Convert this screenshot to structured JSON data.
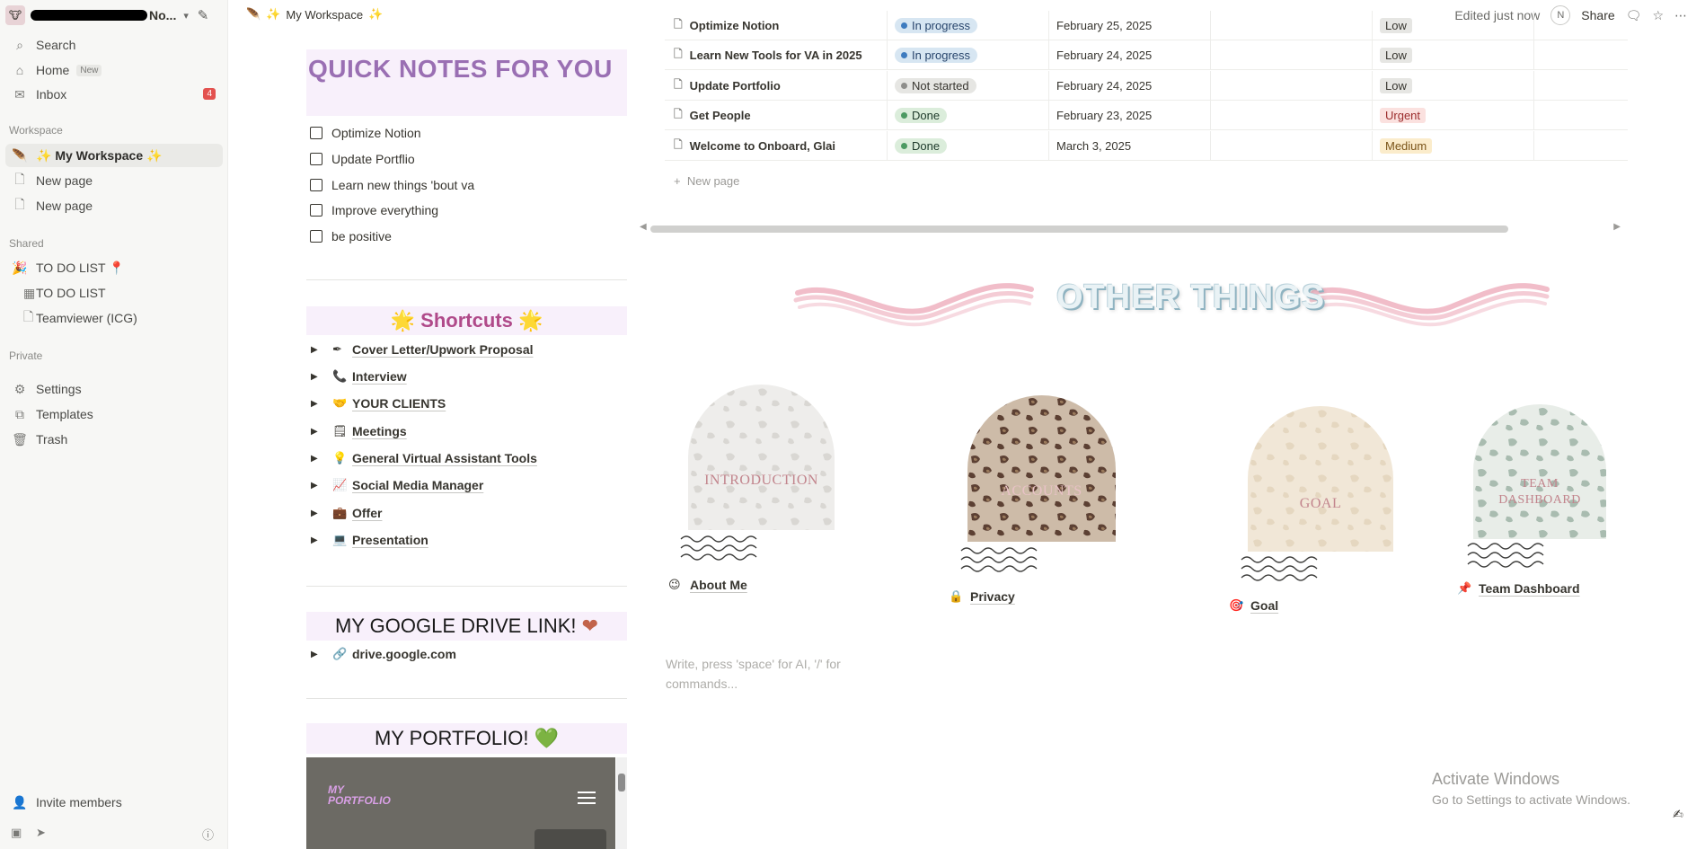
{
  "sidebar": {
    "workspace_suffix": "No...",
    "items": {
      "search": "Search",
      "home": "Home",
      "home_tag": "New",
      "inbox": "Inbox",
      "inbox_count": "4"
    },
    "sections": {
      "workspace": "Workspace",
      "shared": "Shared",
      "private": "Private"
    },
    "workspace_pages": [
      "My Workspace",
      "New page",
      "New page"
    ],
    "shared_pages": [
      "TO DO LIST",
      "TO DO LIST",
      "Teamviewer (ICG)"
    ],
    "private_items": [
      "Settings",
      "Templates",
      "Trash"
    ],
    "invite": "Invite members"
  },
  "topbar": {
    "breadcrumb": "My Workspace",
    "edited": "Edited just now",
    "avatar_initial": "N",
    "share": "Share"
  },
  "quick_notes": {
    "title": "QUICK NOTES FOR YOU",
    "todos": [
      "Optimize Notion",
      "Update Portflio",
      "Learn new things 'bout va",
      "Improve everything",
      "be positive"
    ]
  },
  "shortcuts": {
    "title": "Shortcuts",
    "items": [
      "Cover Letter/Upwork Proposal",
      "Interview",
      "YOUR CLIENTS",
      "Meetings",
      "General Virtual Assistant Tools",
      "Social Media Manager",
      "Offer",
      "Presentation"
    ]
  },
  "google_drive": {
    "title": "MY GOOGLE DRIVE LINK!",
    "link": "drive.google.com"
  },
  "portfolio": {
    "title": "MY PORTFOLIO!",
    "logo_line1": "MY",
    "logo_line2": "PORTFOLIO"
  },
  "table": {
    "rows": [
      {
        "name": "Optimize Notion",
        "status": "In progress",
        "date": "February 25, 2025",
        "priority": "Low"
      },
      {
        "name": "Learn New Tools for VA in 2025",
        "status": "In progress",
        "date": "February 24, 2025",
        "priority": "Low"
      },
      {
        "name": "Update Portfolio",
        "status": "Not started",
        "date": "February 24, 2025",
        "priority": "Low"
      },
      {
        "name": "Get People",
        "status": "Done",
        "date": "February 23, 2025",
        "priority": "Urgent"
      },
      {
        "name": "Welcome to Onboard, Glai",
        "status": "Done",
        "date": "March 3, 2025",
        "priority": "Medium"
      }
    ],
    "new_page": "New page"
  },
  "other_things": {
    "title": "OTHER THINGS",
    "cards": [
      {
        "image_text": "INTRODUCTION",
        "link": "About Me"
      },
      {
        "image_text": "ACCOUNTS",
        "link": "Privacy"
      },
      {
        "image_text": "GOAL",
        "link": "Goal"
      },
      {
        "image_text_1": "TEAM",
        "image_text_2": "DASHBOARD",
        "link": "Team Dashboard"
      }
    ]
  },
  "editor": {
    "placeholder": "Write, press 'space' for AI, '/' for commands..."
  },
  "windows": {
    "line1": "Activate Windows",
    "line2": "Go to Settings to activate Windows."
  },
  "colors": {
    "accent_purple": "#9a6fb3",
    "shortcut_pink": "#b04a8a",
    "panel_bg": "#f8f0fb"
  }
}
